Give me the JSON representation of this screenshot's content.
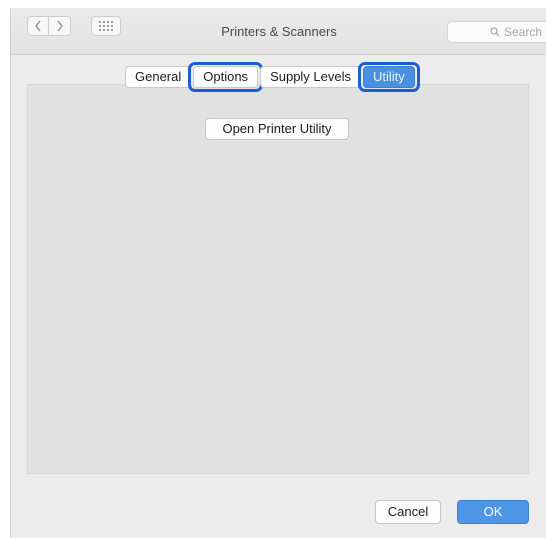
{
  "window": {
    "title": "Printers & Scanners",
    "search_placeholder": "Search"
  },
  "tabs": [
    {
      "label": "General",
      "active": false,
      "highlighted": false
    },
    {
      "label": "Options",
      "active": false,
      "highlighted": true
    },
    {
      "label": "Supply Levels",
      "active": false,
      "highlighted": false
    },
    {
      "label": "Utility",
      "active": true,
      "highlighted": true
    }
  ],
  "pane": {
    "open_utility_label": "Open Printer Utility"
  },
  "footer": {
    "cancel_label": "Cancel",
    "ok_label": "OK"
  },
  "colors": {
    "accent": "#4a90e2",
    "highlight_ring": "#1a5fd6"
  },
  "icons": [
    "chevron-left-icon",
    "chevron-right-icon",
    "grid-icon",
    "search-icon"
  ]
}
